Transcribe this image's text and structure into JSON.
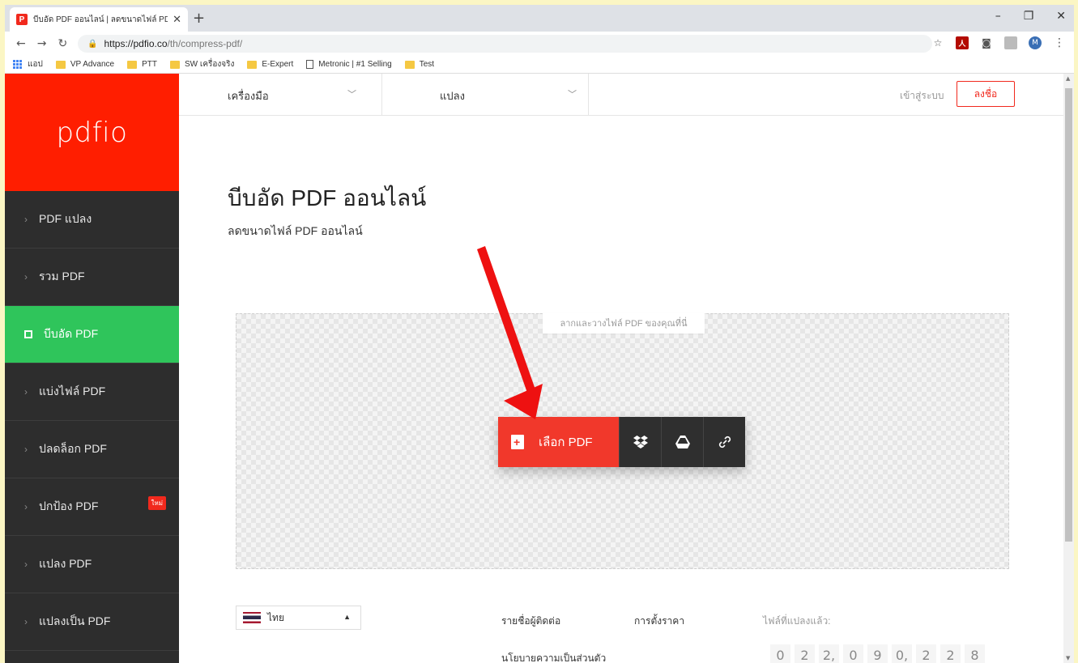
{
  "browser": {
    "tab_title": "บีบอัด PDF ออนไลน์ | ลดขนาดไฟล์ PD",
    "tab_favicon": "P",
    "url_host": "https://pdfio.co",
    "url_path": "/th/compress-pdf/",
    "profile_initial": "M",
    "bookmarks": [
      {
        "label": "แอป",
        "icon": "apps-icon"
      },
      {
        "label": "VP Advance",
        "icon": "folder-icon"
      },
      {
        "label": "PTT",
        "icon": "folder-icon"
      },
      {
        "label": "SW เครื่องจริง",
        "icon": "folder-icon"
      },
      {
        "label": "E-Expert",
        "icon": "folder-icon"
      },
      {
        "label": "Metronic | #1 Selling",
        "icon": "page-icon"
      },
      {
        "label": "Test",
        "icon": "folder-icon"
      }
    ]
  },
  "sidebar": {
    "brand": "pdfio",
    "items": [
      {
        "label": "PDF แปลง"
      },
      {
        "label": "รวม PDF"
      },
      {
        "label": "บีบอัด PDF",
        "active": true
      },
      {
        "label": "แบ่งไฟล์ PDF"
      },
      {
        "label": "ปลดล็อก PDF"
      },
      {
        "label": "ปกป้อง PDF",
        "badge": "ใหม่"
      },
      {
        "label": "แปลง PDF"
      },
      {
        "label": "แปลงเป็น PDF"
      }
    ]
  },
  "topnav": {
    "tools": "เครื่องมือ",
    "convert": "แปลง",
    "login": "เข้าสู่ระบบ",
    "signup": "ลงชื่อ"
  },
  "main": {
    "title": "บีบอัด PDF ออนไลน์",
    "subtitle": "ลดขนาดไฟล์ PDF ออนไลน์",
    "drop_hint": "ลากและวางไฟล์ PDF ของคุณที่นี่",
    "choose_label": "เลือก PDF"
  },
  "footer": {
    "language": "ไทย",
    "contacts": "รายชื่อผู้ติดต่อ",
    "pricing": "การตั้งราคา",
    "converted_label": "ไฟล์ที่แปลงแล้ว:",
    "privacy": "นโยบายความเป็นส่วนตัว",
    "counter": [
      "0",
      "2",
      "2,",
      "0",
      "9",
      "0,",
      "2",
      "2",
      "8"
    ]
  },
  "colors": {
    "brand_red": "#ff1e00",
    "active_green": "#2fc55b",
    "sidebar_bg": "#2d2d2d",
    "annotation_arrow": "#ee1111"
  }
}
